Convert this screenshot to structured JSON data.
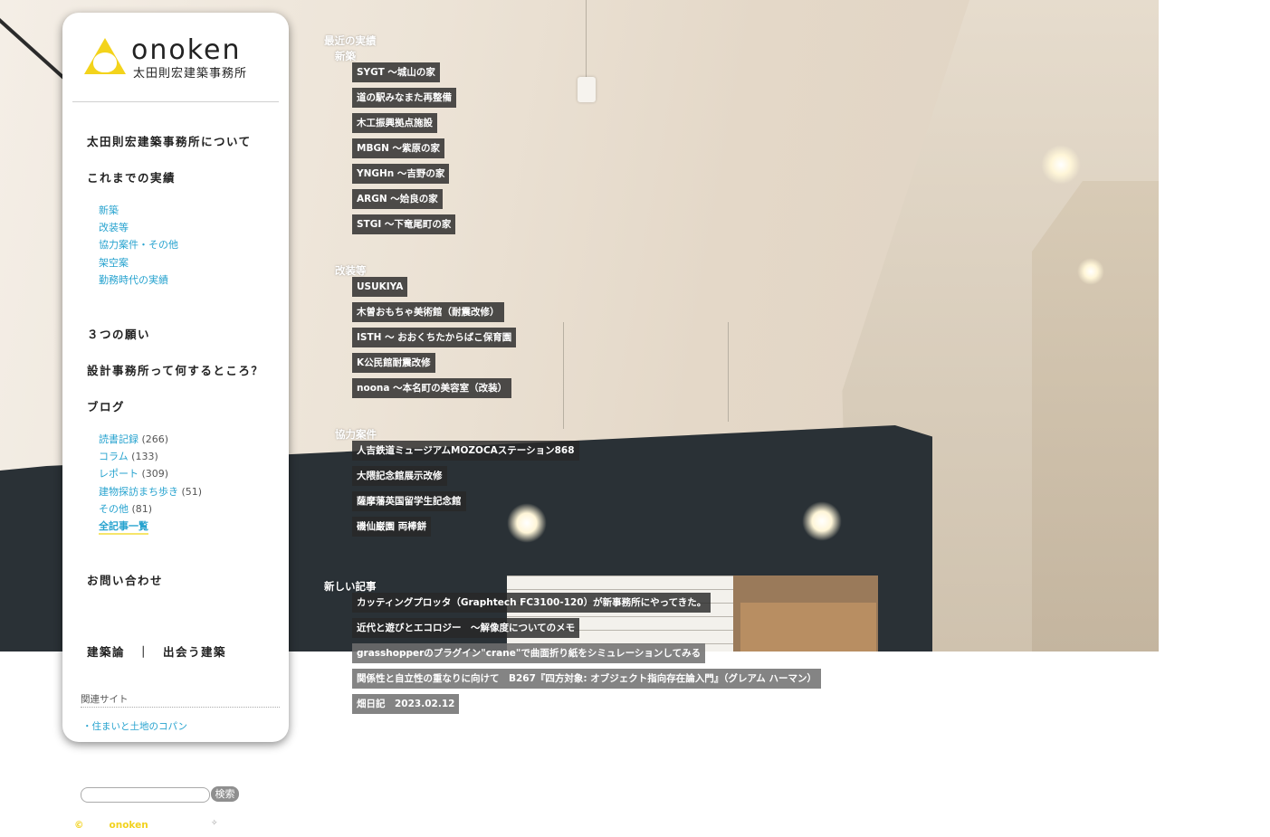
{
  "brand": {
    "name": "onoken",
    "subtitle": "太田則宏建築事務所"
  },
  "sidebar": {
    "about": "太田則宏建築事務所について",
    "works_title": "これまでの実績",
    "works": [
      "新築",
      "改装等",
      "協力案件・その他",
      "架空案",
      "勤務時代の実績"
    ],
    "wishes": "３つの願い",
    "what_is": "設計事務所って何するところ？",
    "blog": "ブログ",
    "blog_cats": [
      {
        "label": "読書記録",
        "count": "(266)"
      },
      {
        "label": "コラム",
        "count": "(133)"
      },
      {
        "label": "レポート",
        "count": "(309)"
      },
      {
        "label": "建物探訪まち歩き",
        "count": "(51)"
      },
      {
        "label": "その他",
        "count": "(81)"
      }
    ],
    "all_posts": "全記事一覧",
    "contact": "お問い合わせ",
    "bottom_links": "建築論　｜　出会う建築",
    "related_title": "関連サイト",
    "related_link": "・住まいと土地のコパン"
  },
  "content": {
    "recent_title": "最近の実績",
    "new_build_title": "新築",
    "new_build": [
      "SYGT 〜城山の家",
      "道の駅みなまた再整備",
      "木工振興拠点施設",
      "MBGN 〜紫原の家",
      "YNGHn 〜吉野の家",
      "ARGN 〜姶良の家",
      "STGI 〜下竜尾町の家"
    ],
    "renovation_title": "改装等",
    "renovation": [
      "USUKIYA",
      "木曽おもちゃ美術館（耐震改修）",
      "ISTH 〜 おおくちたからばこ保育園",
      "K公民館耐震改修",
      "noona 〜本名町の美容室（改装）"
    ],
    "collab_title": "協力案件",
    "collab": [
      "人吉鉄道ミュージアムMOZOCAステーション868",
      "大隈記念館展示改修",
      "薩摩藩英国留学生記念館",
      "磯仙巌園 両棒餅"
    ],
    "news_title": "新しい記事",
    "news": [
      "カッティングプロッタ（Graphtech FC3100-120）が新事務所にやってきた。",
      "近代と遊びとエコロジー　〜解像度についてのメモ",
      "grasshopperのプラグイン\"crane\"で曲面折り紙をシミュレーションしてみる",
      "関係性と自立性の重なりに向けて　B267『四方対象: オブジェクト指向存在論入門』（グレアム ハーマン）",
      "畑日記　2023.02.12"
    ]
  },
  "footer": {
    "search_button": "検索",
    "copyright_symbol": "©",
    "copyright_name": "onoken"
  },
  "colors": {
    "accent_logo": "#f3d31b",
    "link": "#27a3cf"
  }
}
